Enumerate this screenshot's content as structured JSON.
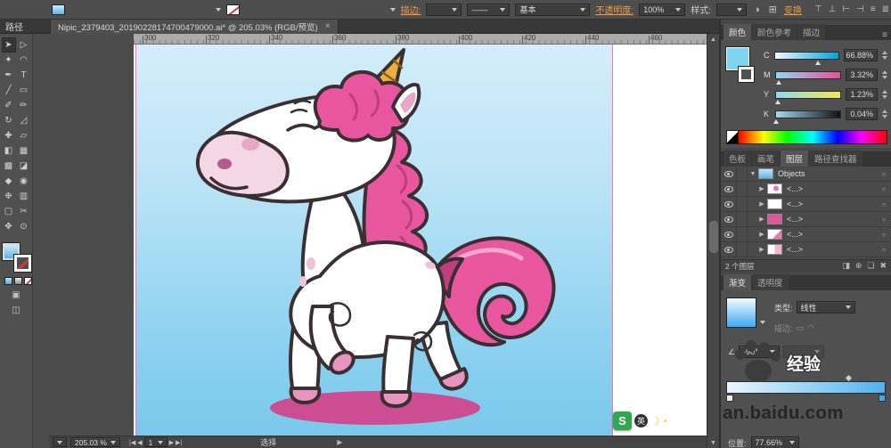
{
  "window": {
    "doc_tab": "Nipic_2379403_20190228174700479000.ai* @ 205.03% (RGB/预览)",
    "close_glyph": "×",
    "selection_type_label": "路径"
  },
  "control_bar": {
    "stroke_label": "描边:",
    "profile_value": "——",
    "brush_value": "基本",
    "opacity_label": "不透明度:",
    "opacity_value": "100%",
    "style_label": "样式:",
    "transform_label": "变换"
  },
  "icons": {
    "panel_menu": "≡",
    "shape_mode": "◑",
    "doc_grid": "⊞",
    "align_1": "⊤",
    "align_2": "⊥",
    "align_3": "⊢",
    "align_4": "⊣",
    "align_5": "≡",
    "align_6": "≣",
    "scroll_up": "▲",
    "scroll_down": "▼",
    "target": "○",
    "angle": "∠",
    "layers_mask": "◨",
    "layers_sublayer": "⊕",
    "layers_new": "❏",
    "layers_delete": "✖",
    "stroke_btn_1": "▭",
    "stroke_btn_2": "◠",
    "draw_mode": "▣",
    "screen_mode": "◫"
  },
  "toolbar": {
    "tools": [
      {
        "name": "selection-tool",
        "glyph": "➤"
      },
      {
        "name": "direct-selection-tool",
        "glyph": "▷"
      },
      {
        "name": "magic-wand-tool",
        "glyph": "✦"
      },
      {
        "name": "lasso-tool",
        "glyph": "◠"
      },
      {
        "name": "pen-tool",
        "glyph": "✒"
      },
      {
        "name": "type-tool",
        "glyph": "T"
      },
      {
        "name": "line-segment-tool",
        "glyph": "╱"
      },
      {
        "name": "rectangle-tool",
        "glyph": "▭"
      },
      {
        "name": "paintbrush-tool",
        "glyph": "✐"
      },
      {
        "name": "pencil-tool",
        "glyph": "✏"
      },
      {
        "name": "rotate-tool",
        "glyph": "↻"
      },
      {
        "name": "scale-tool",
        "glyph": "◿"
      },
      {
        "name": "width-tool",
        "glyph": "✚"
      },
      {
        "name": "free-transform-tool",
        "glyph": "▱"
      },
      {
        "name": "shape-builder-tool",
        "glyph": "◧"
      },
      {
        "name": "perspective-grid-tool",
        "glyph": "▦"
      },
      {
        "name": "mesh-tool",
        "glyph": "▩"
      },
      {
        "name": "gradient-tool",
        "glyph": "◪"
      },
      {
        "name": "eyedropper-tool",
        "glyph": "◆"
      },
      {
        "name": "blend-tool",
        "glyph": "◉"
      },
      {
        "name": "symbol-sprayer-tool",
        "glyph": "❉"
      },
      {
        "name": "column-graph-tool",
        "glyph": "▥"
      },
      {
        "name": "artboard-tool",
        "glyph": "▢"
      },
      {
        "name": "slice-tool",
        "glyph": "✂"
      },
      {
        "name": "hand-tool",
        "glyph": "✥"
      },
      {
        "name": "zoom-tool",
        "glyph": "⊙"
      }
    ]
  },
  "ruler": {
    "labels": [
      "300",
      "320",
      "340",
      "360",
      "380",
      "400",
      "420",
      "440",
      "460"
    ]
  },
  "statusbar": {
    "zoom_value": "205.03 %",
    "artboard_number": "1",
    "nav_first": "|◀",
    "nav_prev": "◀",
    "nav_next": "▶",
    "nav_last": "▶|",
    "hint": "选择",
    "expand_glyph": "▶"
  },
  "ime": {
    "letter": "S",
    "lang_badge": "英",
    "moon": "☽",
    "star": "✦"
  },
  "panels": {
    "color": {
      "tabs": [
        "颜色",
        "颜色参考",
        "描边"
      ],
      "fill_hex": "#7ED3EF",
      "channels": [
        {
          "label": "C",
          "value": "66.88%",
          "pos": 67
        },
        {
          "label": "M",
          "value": "3.32%",
          "pos": 5
        },
        {
          "label": "Y",
          "value": "1.23%",
          "pos": 3
        },
        {
          "label": "K",
          "value": "0.04%",
          "pos": 1
        }
      ]
    },
    "dock_tabs": [
      "色板",
      "画笔",
      "图层",
      "路径查找器"
    ],
    "layers": {
      "rows": [
        {
          "arrow": "▼",
          "name": "Objects"
        },
        {
          "arrow": "▶",
          "name": "<...>"
        },
        {
          "arrow": "▶",
          "name": "<...>"
        },
        {
          "arrow": "▶",
          "name": "<...>"
        },
        {
          "arrow": "▶",
          "name": "<...>"
        },
        {
          "arrow": "▶",
          "name": "<...>"
        }
      ],
      "count_label": "2 个图层"
    },
    "gradient": {
      "tabs": [
        "渐变",
        "透明度"
      ],
      "type_label": "类型:",
      "type_value": "线性",
      "stroke_label": "描边:",
      "angle_value": "-90°",
      "position_label": "位置:",
      "position_value": "77.66%",
      "position_pos": 77.66
    }
  },
  "watermark": {
    "domain_text": "an.baidu.com",
    "badge_text": "经验"
  },
  "artwork_palette": {
    "mane_pink": "#E7569E",
    "mane_dark": "#C03D7E",
    "body_white": "#FFFFFF",
    "horn_gold": "#EDAE3E",
    "shadow_pink": "#CC4D92",
    "hoof_pink": "#E794BF",
    "canvas_top": "#D4EDFA",
    "canvas_bottom": "#7AC8EC",
    "link_orange": "#F09A43"
  }
}
